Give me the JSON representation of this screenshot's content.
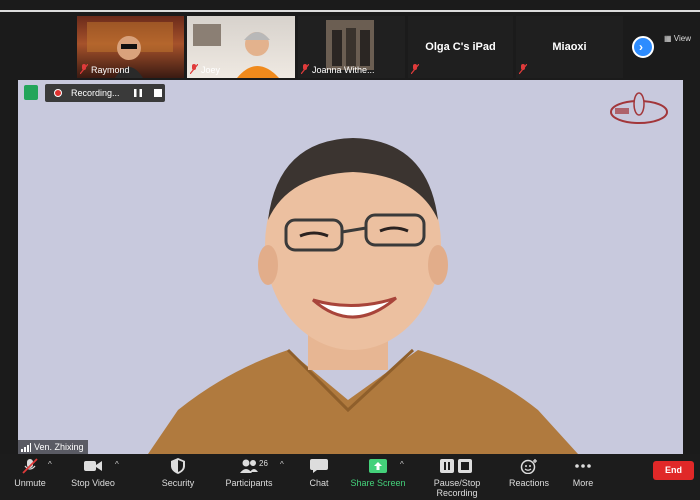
{
  "gallery": {
    "participants": [
      {
        "name": "Raymond",
        "muted": true
      },
      {
        "name": "Joey",
        "muted": true
      },
      {
        "name": "Joanna Withe...",
        "muted": true
      },
      {
        "name": "Olga C's iPad",
        "muted": true
      },
      {
        "name": "Miaoxi",
        "muted": true
      }
    ],
    "view_label": "View"
  },
  "main": {
    "recording_label": "Recording...",
    "speaker_name": "Ven. Zhixing"
  },
  "toolbar": {
    "unmute": "Unmute",
    "stop_video": "Stop Video",
    "security": "Security",
    "participants": "Participants",
    "participants_count": "26",
    "chat": "Chat",
    "share_screen": "Share Screen",
    "pause_stop_recording": "Pause/Stop Recording",
    "reactions": "Reactions",
    "more": "More",
    "end": "End"
  },
  "colors": {
    "share_green": "#44d17a",
    "end_red": "#e02828",
    "accent_blue": "#2d8cff",
    "main_background": "#c8c9dd"
  }
}
